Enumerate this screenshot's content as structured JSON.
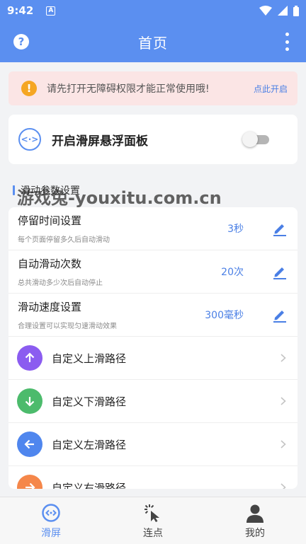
{
  "status_bar": {
    "time": "9:42",
    "notif_letter": "A"
  },
  "app_bar": {
    "title": "首页",
    "help_glyph": "?"
  },
  "alert": {
    "message": "请先打开无障碍权限才能正常使用哦!",
    "action": "点此开启",
    "icon_glyph": "!"
  },
  "floating_panel": {
    "label": "开启滑屏悬浮面板",
    "enabled": false,
    "icon_glyph": "<·>"
  },
  "section": {
    "title": "滑动参数设置"
  },
  "settings": [
    {
      "title": "停留时间设置",
      "subtitle": "每个页面停留多久后自动滑动",
      "value": "3秒"
    },
    {
      "title": "自动滑动次数",
      "subtitle": "总共滑动多少次后自动停止",
      "value": "20次"
    },
    {
      "title": "滑动速度设置",
      "subtitle": "合理设置可以实现匀速滑动效果",
      "value": "300毫秒"
    }
  ],
  "paths": [
    {
      "label": "自定义上滑路径",
      "color": "#8b5cf0",
      "icon": "arrow-up-icon"
    },
    {
      "label": "自定义下滑路径",
      "color": "#4cbb6c",
      "icon": "arrow-down-icon"
    },
    {
      "label": "自定义左滑路径",
      "color": "#4f86ee",
      "icon": "arrow-left-icon"
    },
    {
      "label": "自定义右滑路径",
      "color": "#f5874a",
      "icon": "arrow-right-icon"
    }
  ],
  "watermark": "游戏兔-youxitu.com.cn",
  "bottom_nav": [
    {
      "label": "滑屏",
      "active": true
    },
    {
      "label": "连点",
      "active": false
    },
    {
      "label": "我的",
      "active": false
    }
  ],
  "colors": {
    "primary": "#5b8ff0",
    "alert_bg": "#fbe5e5",
    "warn": "#f5a623",
    "value_blue": "#4a7fe5"
  }
}
